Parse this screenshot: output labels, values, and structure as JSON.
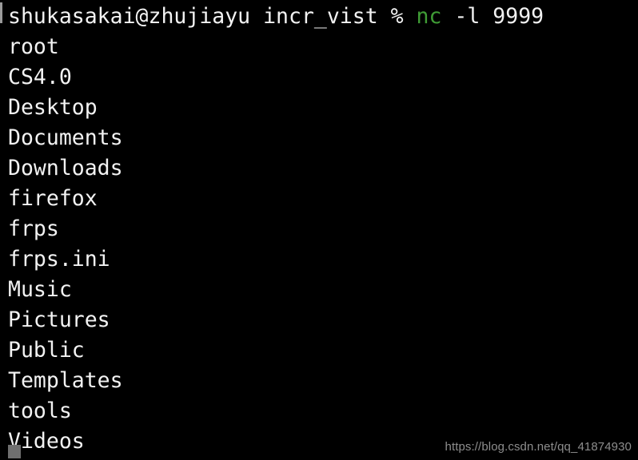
{
  "terminal": {
    "background_color": "#000000",
    "foreground_color": "#f2f2f2",
    "accent_green": "#3f9c35",
    "cursor_color": "#6f6f6f",
    "prompt_line": {
      "user_host_dir": "shukasakai@zhujiayu incr_vist % ",
      "command_name": "nc",
      "command_args": " -l 9999"
    },
    "output_lines": [
      "root",
      "CS4.0",
      "Desktop",
      "Documents",
      "Downloads",
      "firefox",
      "frps",
      "frps.ini",
      "Music",
      "Pictures",
      "Public",
      "Templates",
      "tools",
      "Videos"
    ]
  },
  "watermark": {
    "text": "https://blog.csdn.net/qq_41874930",
    "color": "#8d8d8d"
  }
}
